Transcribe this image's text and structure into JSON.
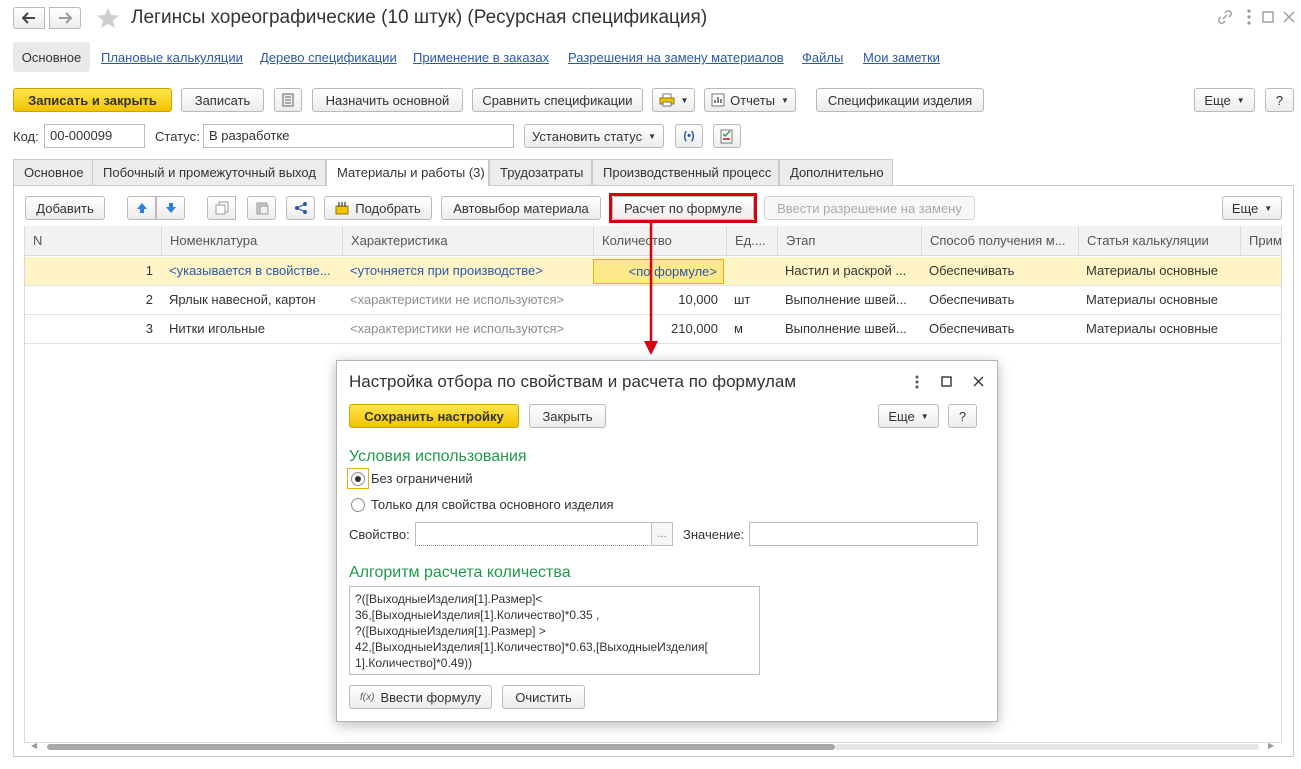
{
  "header": {
    "title": "Легинсы хореографические (10 штук) (Ресурсная спецификация)"
  },
  "nav_links": [
    "Основное",
    "Плановые калькуляции",
    "Дерево спецификации",
    "Применение в заказах",
    "Разрешения на замену материалов",
    "Файлы",
    "Мои заметки"
  ],
  "toolbar": {
    "save_close": "Записать и закрыть",
    "save": "Записать",
    "set_main": "Назначить основной",
    "compare": "Сравнить спецификации",
    "reports": "Отчеты",
    "product_specs": "Спецификации изделия",
    "more": "Еще",
    "help": "?"
  },
  "fields": {
    "code_label": "Код:",
    "code_value": "00-000099",
    "status_label": "Статус:",
    "status_value": "В разработке",
    "set_status": "Установить статус"
  },
  "tabs": [
    "Основное",
    "Побочный и промежуточный выход",
    "Материалы и работы (3)",
    "Трудозатраты",
    "Производственный процесс",
    "Дополнительно"
  ],
  "grid_toolbar": {
    "add": "Добавить",
    "pick": "Подобрать",
    "auto_material": "Автовыбор материала",
    "formula_calc": "Расчет по формуле",
    "enter_permission": "Ввести разрешение на замену",
    "more": "Еще"
  },
  "table": {
    "columns": [
      "N",
      "Номенклатура",
      "Характеристика",
      "Количество",
      "Ед....",
      "Этап",
      "Способ получения м...",
      "Статья калькуляции",
      "Приме"
    ],
    "rows": [
      [
        "1",
        "<указывается в свойстве...",
        "<уточняется при производстве>",
        "<по формуле>",
        "",
        "Настил и раскрой ...",
        "Обеспечивать",
        "Материалы основные"
      ],
      [
        "2",
        "Ярлык навесной, картон",
        "<характеристики не используются>",
        "10,000",
        "шт",
        "Выполнение швей...",
        "Обеспечивать",
        "Материалы основные"
      ],
      [
        "3",
        "Нитки игольные",
        "<характеристики не используются>",
        "210,000",
        "м",
        "Выполнение швей...",
        "Обеспечивать",
        "Материалы основные"
      ]
    ]
  },
  "dialog": {
    "title": "Настройка отбора по свойствам и расчета по формулам",
    "save_settings": "Сохранить настройку",
    "close": "Закрыть",
    "more": "Еще",
    "help": "?",
    "conditions_title": "Условия использования",
    "radio_no_limits": "Без ограничений",
    "radio_main_only": "Только для свойства основного изделия",
    "property_label": "Свойство:",
    "value_label": "Значение:",
    "algorithm_title": "Алгоритм расчета количества",
    "formula_lines": [
      "?([ВыходныеИзделия[1].Размер]<",
      "36,[ВыходныеИзделия[1].Количество]*0.35 ,",
      "?([ВыходныеИзделия[1].Размер] >",
      "42,[ВыходныеИзделия[1].Количество]*0.63,[ВыходныеИзделия[",
      "1].Количество]*0.49))"
    ],
    "enter_formula": "Ввести формулу",
    "clear": "Очистить"
  },
  "colors": {
    "accent_yellow": "#f5cc00",
    "highlight_red": "#d9000d",
    "section_green": "#1f9a4a",
    "link_blue": "#2b59a8"
  }
}
